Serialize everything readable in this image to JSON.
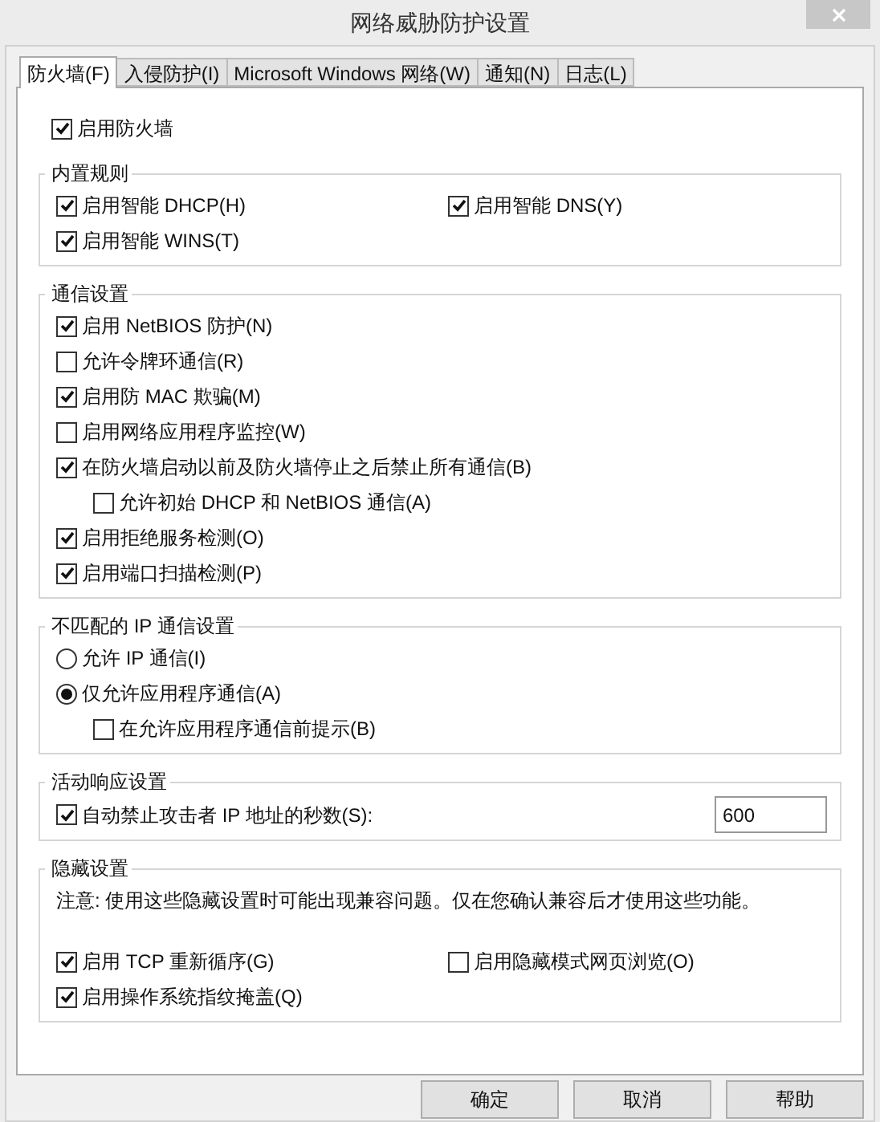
{
  "window": {
    "title": "网络威胁防护设置"
  },
  "tabs": [
    {
      "label": "防火墙(F)",
      "selected": true
    },
    {
      "label": "入侵防护(I)",
      "selected": false
    },
    {
      "label": "Microsoft Windows 网络(W)",
      "selected": false
    },
    {
      "label": "通知(N)",
      "selected": false
    },
    {
      "label": "日志(L)",
      "selected": false
    }
  ],
  "enable_firewall": {
    "label": "启用防火墙",
    "checked": true
  },
  "groups": [
    {
      "title": "内置规则",
      "kind": "grid",
      "items": [
        {
          "kind": "checkbox",
          "label": "启用智能 DHCP(H)",
          "checked": true
        },
        {
          "kind": "checkbox",
          "label": "启用智能 DNS(Y)",
          "checked": true
        },
        {
          "kind": "checkbox",
          "label": "启用智能 WINS(T)",
          "checked": true
        }
      ]
    },
    {
      "title": "通信设置",
      "kind": "list",
      "items": [
        {
          "kind": "checkbox",
          "label": "启用 NetBIOS 防护(N)",
          "checked": true
        },
        {
          "kind": "checkbox",
          "label": "允许令牌环通信(R)",
          "checked": false
        },
        {
          "kind": "checkbox",
          "label": "启用防 MAC 欺骗(M)",
          "checked": true
        },
        {
          "kind": "checkbox",
          "label": "启用网络应用程序监控(W)",
          "checked": false
        },
        {
          "kind": "checkbox",
          "label": "在防火墙启动以前及防火墙停止之后禁止所有通信(B)",
          "checked": true,
          "children": [
            {
              "kind": "checkbox",
              "label": "允许初始 DHCP 和 NetBIOS 通信(A)",
              "checked": false
            }
          ]
        },
        {
          "kind": "checkbox",
          "label": "启用拒绝服务检测(O)",
          "checked": true
        },
        {
          "kind": "checkbox",
          "label": "启用端口扫描检测(P)",
          "checked": true
        }
      ]
    },
    {
      "title": "不匹配的 IP 通信设置",
      "kind": "list",
      "items": [
        {
          "kind": "radio",
          "label": "允许 IP 通信(I)",
          "selected": false
        },
        {
          "kind": "radio",
          "label": "仅允许应用程序通信(A)",
          "selected": true,
          "children": [
            {
              "kind": "checkbox",
              "label": "在允许应用程序通信前提示(B)",
              "checked": false
            }
          ]
        }
      ]
    },
    {
      "title": "活动响应设置",
      "kind": "list",
      "items": [
        {
          "kind": "checkbox_field",
          "label": "自动禁止攻击者 IP 地址的秒数(S):",
          "checked": true,
          "value": "600"
        }
      ]
    },
    {
      "title": "隐藏设置",
      "kind": "grid",
      "note": "注意: 使用这些隐藏设置时可能出现兼容问题。仅在您确认兼容后才使用这些功能。",
      "items": [
        {
          "kind": "checkbox",
          "label": "启用 TCP 重新循序(G)",
          "checked": true
        },
        {
          "kind": "checkbox",
          "label": "启用隐藏模式网页浏览(O)",
          "checked": false
        },
        {
          "kind": "checkbox",
          "label": "启用操作系统指纹掩盖(Q)",
          "checked": true
        }
      ]
    }
  ],
  "buttons": [
    "确定",
    "取消",
    "帮助"
  ]
}
